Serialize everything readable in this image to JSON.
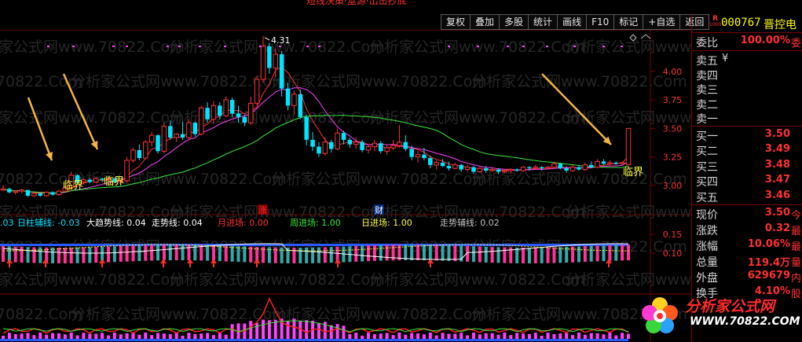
{
  "toolbar": {
    "items": [
      "复权",
      "叠加",
      "多股",
      "统计",
      "画线",
      "F10",
      "标记",
      "+自选",
      "返回"
    ]
  },
  "title_fragment": "短线决策·筮源·出击抄底",
  "stock": {
    "badge_top": "R",
    "badge_bottom": "1000",
    "code": "000767",
    "name": "晋控电"
  },
  "quote_panel": {
    "wei_bi": {
      "label": "委比",
      "value": "100.00%",
      "ext": "委"
    },
    "sell": [
      {
        "label": "卖五",
        "mark": "¥",
        "value": ""
      },
      {
        "label": "卖四",
        "value": ""
      },
      {
        "label": "卖三",
        "value": ""
      },
      {
        "label": "卖二",
        "value": ""
      },
      {
        "label": "卖一",
        "value": ""
      }
    ],
    "buy": [
      {
        "label": "买一",
        "value": "3.50"
      },
      {
        "label": "买二",
        "value": "3.49"
      },
      {
        "label": "买三",
        "value": "3.48"
      },
      {
        "label": "买四",
        "value": "3.47"
      },
      {
        "label": "买五",
        "value": "3.46"
      }
    ],
    "stats": [
      {
        "label": "现价",
        "value": "3.50",
        "ext": "今"
      },
      {
        "label": "涨跌",
        "value": "0.32",
        "ext": "最"
      },
      {
        "label": "涨幅",
        "value": "10.06%",
        "ext": "最"
      },
      {
        "label": "总量",
        "value": "119.4万",
        "ext": "量"
      },
      {
        "label": "外盘",
        "value": "629679",
        "ext": "内"
      },
      {
        "label": "换手",
        "value": "4.10%",
        "ext": "股"
      }
    ]
  },
  "watermarks": {
    "main": "分析家公式网www.70822.Com",
    "lower": "分析家公式网www.70822.Com"
  },
  "logo": {
    "text": "分析家公式网",
    "url": "WWW.70822.COM"
  },
  "colors": {
    "up": "#ff3333",
    "down": "#00e5ff",
    "ma_fast": "#ff3030",
    "ma_mid": "#ff40ff",
    "ma_slow": "#38e838",
    "stripe_up": "#ff3399",
    "stripe_down": "#33aaaa",
    "arrow": "#f5b440",
    "label_yellow": "#ffff40"
  },
  "chart_data": {
    "type": "candlestick",
    "price_axis": {
      "ticks": [
        3.0,
        3.25,
        3.5,
        3.75,
        4.0
      ],
      "ylim": [
        2.82,
        4.35
      ]
    },
    "indicator_axis": {
      "ticks": [
        0.15,
        0.1
      ]
    },
    "candles": [
      [
        2.96,
        3.0,
        2.95,
        2.97
      ],
      [
        2.97,
        2.98,
        2.93,
        2.94
      ],
      [
        2.94,
        2.96,
        2.92,
        2.95
      ],
      [
        2.95,
        2.97,
        2.93,
        2.96
      ],
      [
        2.96,
        2.96,
        2.9,
        2.91
      ],
      [
        2.91,
        2.94,
        2.9,
        2.93
      ],
      [
        2.93,
        2.94,
        2.9,
        2.91
      ],
      [
        2.91,
        2.95,
        2.9,
        2.94
      ],
      [
        2.94,
        2.95,
        2.91,
        2.92
      ],
      [
        2.92,
        2.96,
        2.91,
        2.95
      ],
      [
        2.95,
        3.0,
        2.94,
        2.98
      ],
      [
        2.98,
        3.12,
        2.97,
        3.09
      ],
      [
        3.09,
        3.1,
        3.01,
        3.03
      ],
      [
        3.03,
        3.06,
        3.01,
        3.05
      ],
      [
        3.05,
        3.06,
        3.02,
        3.03
      ],
      [
        3.03,
        3.07,
        3.02,
        3.06
      ],
      [
        3.06,
        3.07,
        3.03,
        3.05
      ],
      [
        3.05,
        3.08,
        3.04,
        3.06
      ],
      [
        3.06,
        3.07,
        3.02,
        3.03
      ],
      [
        3.03,
        3.05,
        3.02,
        3.04
      ],
      [
        3.04,
        3.25,
        3.03,
        3.22
      ],
      [
        3.22,
        3.33,
        3.2,
        3.31
      ],
      [
        3.31,
        3.36,
        3.22,
        3.24
      ],
      [
        3.24,
        3.4,
        3.23,
        3.38
      ],
      [
        3.38,
        3.47,
        3.34,
        3.44
      ],
      [
        3.44,
        3.45,
        3.28,
        3.3
      ],
      [
        3.3,
        3.55,
        3.28,
        3.52
      ],
      [
        3.52,
        3.57,
        3.4,
        3.42
      ],
      [
        3.42,
        3.46,
        3.38,
        3.45
      ],
      [
        3.45,
        3.56,
        3.4,
        3.42
      ],
      [
        3.42,
        3.58,
        3.4,
        3.55
      ],
      [
        3.55,
        3.56,
        3.43,
        3.45
      ],
      [
        3.45,
        3.7,
        3.44,
        3.68
      ],
      [
        3.68,
        3.73,
        3.55,
        3.58
      ],
      [
        3.58,
        3.74,
        3.54,
        3.7
      ],
      [
        3.7,
        3.73,
        3.58,
        3.61
      ],
      [
        3.61,
        3.78,
        3.6,
        3.75
      ],
      [
        3.75,
        3.77,
        3.6,
        3.63
      ],
      [
        3.63,
        3.7,
        3.55,
        3.6
      ],
      [
        3.6,
        3.62,
        3.52,
        3.55
      ],
      [
        3.55,
        3.78,
        3.53,
        3.72
      ],
      [
        3.72,
        3.96,
        3.7,
        3.93
      ],
      [
        3.93,
        4.31,
        3.9,
        4.22
      ],
      [
        4.22,
        4.25,
        3.98,
        4.03
      ],
      [
        4.03,
        4.2,
        3.95,
        4.15
      ],
      [
        4.15,
        4.18,
        3.78,
        3.85
      ],
      [
        3.85,
        3.9,
        3.66,
        3.7
      ],
      [
        3.7,
        3.83,
        3.62,
        3.8
      ],
      [
        3.8,
        3.84,
        3.58,
        3.6
      ],
      [
        3.6,
        3.62,
        3.35,
        3.4
      ],
      [
        3.4,
        3.47,
        3.3,
        3.34
      ],
      [
        3.34,
        3.38,
        3.25,
        3.28
      ],
      [
        3.28,
        3.42,
        3.26,
        3.38
      ],
      [
        3.38,
        3.4,
        3.29,
        3.32
      ],
      [
        3.32,
        3.5,
        3.31,
        3.46
      ],
      [
        3.46,
        3.48,
        3.36,
        3.4
      ],
      [
        3.4,
        3.42,
        3.33,
        3.36
      ],
      [
        3.36,
        3.42,
        3.32,
        3.38
      ],
      [
        3.38,
        3.4,
        3.29,
        3.31
      ],
      [
        3.31,
        3.36,
        3.28,
        3.34
      ],
      [
        3.34,
        3.4,
        3.3,
        3.37
      ],
      [
        3.37,
        3.39,
        3.28,
        3.3
      ],
      [
        3.3,
        3.36,
        3.27,
        3.33
      ],
      [
        3.33,
        3.4,
        3.31,
        3.35
      ],
      [
        3.35,
        3.53,
        3.33,
        3.38
      ],
      [
        3.38,
        3.44,
        3.3,
        3.32
      ],
      [
        3.32,
        3.35,
        3.22,
        3.25
      ],
      [
        3.25,
        3.3,
        3.2,
        3.27
      ],
      [
        3.27,
        3.33,
        3.22,
        3.24
      ],
      [
        3.24,
        3.26,
        3.15,
        3.18
      ],
      [
        3.18,
        3.22,
        3.14,
        3.2
      ],
      [
        3.2,
        3.23,
        3.16,
        3.17
      ],
      [
        3.17,
        3.21,
        3.13,
        3.15
      ],
      [
        3.15,
        3.2,
        3.14,
        3.18
      ],
      [
        3.18,
        3.19,
        3.12,
        3.14
      ],
      [
        3.14,
        3.18,
        3.12,
        3.16
      ],
      [
        3.16,
        3.17,
        3.1,
        3.12
      ],
      [
        3.12,
        3.16,
        3.11,
        3.15
      ],
      [
        3.15,
        3.17,
        3.11,
        3.13
      ],
      [
        3.13,
        3.16,
        3.12,
        3.14
      ],
      [
        3.14,
        3.15,
        3.1,
        3.12
      ],
      [
        3.12,
        3.14,
        3.11,
        3.13
      ],
      [
        3.13,
        3.15,
        3.11,
        3.14
      ],
      [
        3.14,
        3.15,
        3.12,
        3.13
      ],
      [
        3.13,
        3.17,
        3.12,
        3.16
      ],
      [
        3.16,
        3.17,
        3.13,
        3.15
      ],
      [
        3.15,
        3.18,
        3.14,
        3.16
      ],
      [
        3.16,
        3.17,
        3.13,
        3.15
      ],
      [
        3.15,
        3.17,
        3.14,
        3.16
      ],
      [
        3.16,
        3.21,
        3.15,
        3.19
      ],
      [
        3.19,
        3.2,
        3.14,
        3.15
      ],
      [
        3.15,
        3.17,
        3.11,
        3.13
      ],
      [
        3.13,
        3.18,
        3.12,
        3.16
      ],
      [
        3.16,
        3.18,
        3.13,
        3.14
      ],
      [
        3.14,
        3.2,
        3.13,
        3.18
      ],
      [
        3.18,
        3.21,
        3.15,
        3.16
      ],
      [
        3.16,
        3.23,
        3.15,
        3.21
      ],
      [
        3.21,
        3.23,
        3.18,
        3.19
      ],
      [
        3.19,
        3.22,
        3.17,
        3.2
      ],
      [
        3.2,
        3.21,
        3.18,
        3.19
      ],
      [
        3.19,
        3.21,
        3.18,
        3.2
      ],
      [
        3.18,
        3.5,
        3.18,
        3.5
      ]
    ],
    "peak_label": "4.31",
    "signal_label": "临界",
    "lower_labels": {
      "zhang": "涨",
      "cai": "财"
    },
    "indicator_legend": [
      {
        "text": ".03",
        "color": "#00e5ff"
      },
      {
        "text": "日柱辅线: -0.03",
        "color": "#00e5ff"
      },
      {
        "text": "大趋势线: 0.04",
        "color": "#ffffff"
      },
      {
        "text": "走势线: 0.04",
        "color": "#ffffff"
      },
      {
        "text": "月进场: 0.00",
        "color": "#ff3030"
      },
      {
        "text": "周进场: 1.00",
        "color": "#38e838"
      },
      {
        "text": "日进场: 1.00",
        "color": "#ffff40"
      },
      {
        "text": "走势辅线: 0.02",
        "color": "#c0c0c0"
      }
    ]
  }
}
